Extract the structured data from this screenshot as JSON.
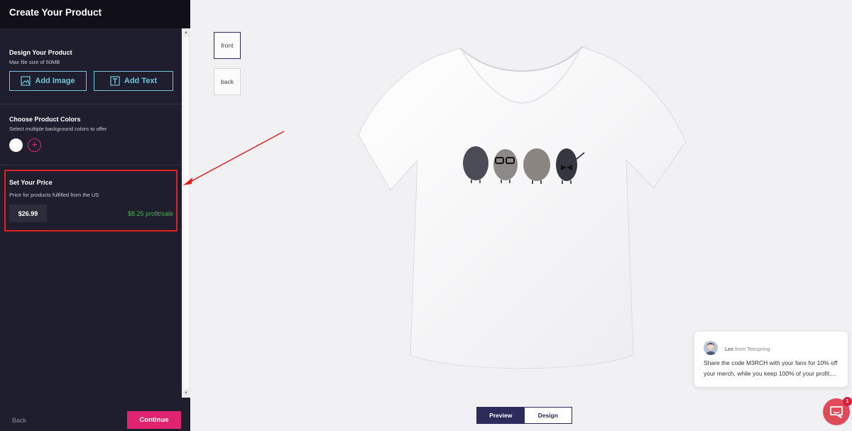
{
  "header": {
    "title": "Create Your Product"
  },
  "design": {
    "title": "Design Your Product",
    "subtitle": "Max file size of 50MB",
    "add_image_label": "Add Image",
    "add_text_label": "Add Text"
  },
  "colors": {
    "title": "Choose Product Colors",
    "subtitle": "Select multiple background colors to offer",
    "selected_color": "#ffffff",
    "add_icon": "plus-icon"
  },
  "price": {
    "title": "Set Your Price",
    "subtitle": "Price for products fulfilled from the US",
    "value": "$26.99",
    "profit": "$8.25 profit/sale"
  },
  "footer": {
    "back_label": "Back",
    "continue_label": "Continue"
  },
  "views": {
    "front_label": "front",
    "back_label": "back",
    "active": "front"
  },
  "toggle": {
    "preview_label": "Preview",
    "design_label": "Design",
    "active": "Preview"
  },
  "chat": {
    "sender": "Lex",
    "from_label": "from Teespring",
    "message": "Share the code M3RCH with your fans for 10% off your merch, while you keep 100% of your profit....",
    "badge_count": "1"
  },
  "accent_colors": {
    "brand_pink": "#e0236f",
    "teal": "#6fc6d8",
    "profit_green": "#4cb050",
    "navy": "#2c2b5b"
  }
}
